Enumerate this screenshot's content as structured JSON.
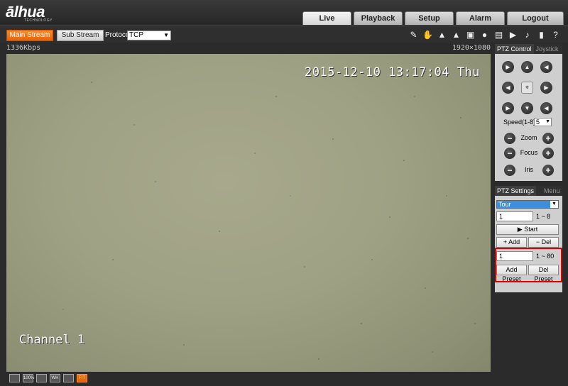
{
  "header": {
    "logo": "ālhua",
    "logo_sub": "TECHNOLOGY",
    "tabs": [
      "Live",
      "Playback",
      "Setup",
      "Alarm",
      "Logout"
    ],
    "active_tab": "Live"
  },
  "toolbar": {
    "main_stream": "Main Stream",
    "sub_stream": "Sub Stream",
    "protocol_label": "Protocol",
    "protocol_value": "TCP",
    "icons": [
      "zoom-icon",
      "hand-icon",
      "alarm-icon",
      "alarm-icon",
      "region-icon",
      "record-icon",
      "snapshot-icon",
      "video-icon",
      "volume-icon",
      "mic-icon",
      "help-icon"
    ]
  },
  "info": {
    "bitrate": "1336Kbps",
    "resolution": "1920×1080"
  },
  "video": {
    "timestamp": "2015-12-10 13:17:04 Thu",
    "channel": "Channel 1"
  },
  "bottom_icons": [
    "fullscreen-icon",
    "100%",
    "fit-icon",
    "wh-icon",
    "ratio-icon",
    "fit-active-icon"
  ],
  "bottom_labels": [
    "",
    "100%",
    "",
    "WH",
    "",
    "FIT"
  ],
  "ptz_control": {
    "tabs": [
      "PTZ Control",
      "Joystick"
    ],
    "speed_label": "Speed(1-8):",
    "speed_value": "5",
    "zoom": "Zoom",
    "focus": "Focus",
    "iris": "Iris"
  },
  "ptz_settings": {
    "tabs": [
      "PTZ Settings",
      "Menu"
    ],
    "mode": "Tour",
    "tour_value": "1",
    "tour_range": "1 ~ 8",
    "start": "Start",
    "add": "Add",
    "del": "Del",
    "preset_value": "1",
    "preset_range": "1 ~ 80",
    "add_preset": "Add Preset",
    "del_preset": "Del Preset"
  },
  "colors": {
    "accent": "#e4640a",
    "highlight": "#e00000",
    "tour_select": "#3d8fdc"
  }
}
